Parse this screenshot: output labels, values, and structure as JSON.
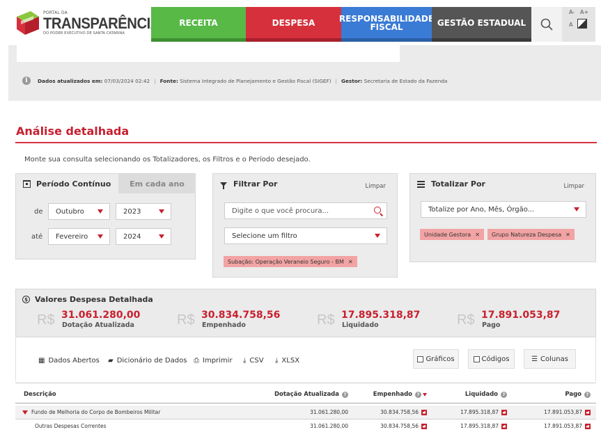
{
  "logo": {
    "small": "PORTAL DA",
    "big": "TRANSPARÊNCIA",
    "sub": "DO PODER EXECUTIVO DE SANTA CATARINA"
  },
  "nav": {
    "receita": "RECEITA",
    "despesa": "DESPESA",
    "responsabilidade": "RESPONSABILIDADE FISCAL",
    "gestao": "GESTÃO ESTADUAL",
    "font_smaller": "A-",
    "font_larger": "A+",
    "contrast_label": "A"
  },
  "info": {
    "updated_label": "Dados atualizados em:",
    "updated_value": "07/03/2024 02:42",
    "fonte_label": "Fonte:",
    "fonte_value": "Sistema Integrado de Planejamento e Gestão Fiscal (SIGEF)",
    "gestor_label": "Gestor:",
    "gestor_value": "Secretaria de Estado da Fazenda",
    "separator": "|"
  },
  "page": {
    "title": "Análise detalhada",
    "subtitle": "Monte sua consulta selecionando os Totalizadores, os Filtros e o Período desejado."
  },
  "periodo": {
    "tab_active": "Período Contínuo",
    "tab_inactive": "Em cada ano",
    "de_label": "de",
    "ate_label": "até",
    "de_month": "Outubro",
    "de_year": "2023",
    "ate_month": "Fevereiro",
    "ate_year": "2024"
  },
  "filtrar": {
    "title": "Filtrar Por",
    "limpar": "Limpar",
    "search_placeholder": "Digite o que você procura...",
    "select_filter": "Selecione um filtro",
    "chips": [
      "Subação: Operação Veraneio Seguro - BM"
    ]
  },
  "totalizar": {
    "title": "Totalizar Por",
    "limpar": "Limpar",
    "select": "Totalize por Ano, Mês, Órgão...",
    "chips": [
      "Unidade Gestora",
      "Grupo Natureza Despesa"
    ]
  },
  "valores": {
    "title": "Valores Despesa Detalhada",
    "currency": "R$",
    "items": [
      {
        "value": "31.061.280,00",
        "label": "Dotação Atualizada"
      },
      {
        "value": "30.834.758,56",
        "label": "Empenhado"
      },
      {
        "value": "17.895.318,87",
        "label": "Liquidado"
      },
      {
        "value": "17.891.053,87",
        "label": "Pago"
      }
    ]
  },
  "toolbar": {
    "dados_abertos": "Dados Abertos",
    "dicionario": "Dicionário de Dados",
    "imprimir": "Imprimir",
    "csv": "CSV",
    "xlsx": "XLSX",
    "graficos": "Gráficos",
    "codigos": "Códigos",
    "colunas": "Colunas"
  },
  "table": {
    "headers": [
      "Descrição",
      "Dotação Atualizada",
      "Empenhado",
      "Liquidado",
      "Pago"
    ],
    "rows": [
      {
        "descricao": "Fundo de Melhoria do Corpo de Bombeiros Militar",
        "dotacao": "31.061.280,00",
        "empenhado": "30.834.758,56",
        "liquidado": "17.895.318,87",
        "pago": "17.891.053,87"
      },
      {
        "descricao": "Outras Despesas Correntes",
        "dotacao": "31.061.280,00",
        "empenhado": "30.834.758,56",
        "liquidado": "17.895.318,87",
        "pago": "17.891.053,87"
      }
    ]
  },
  "colors": {
    "receita": "#58b947",
    "despesa": "#d6303d",
    "responsabilidade": "#3a7bd5",
    "gestao": "#555555",
    "accent": "#c8202f",
    "chip": "#f2a3a3"
  }
}
